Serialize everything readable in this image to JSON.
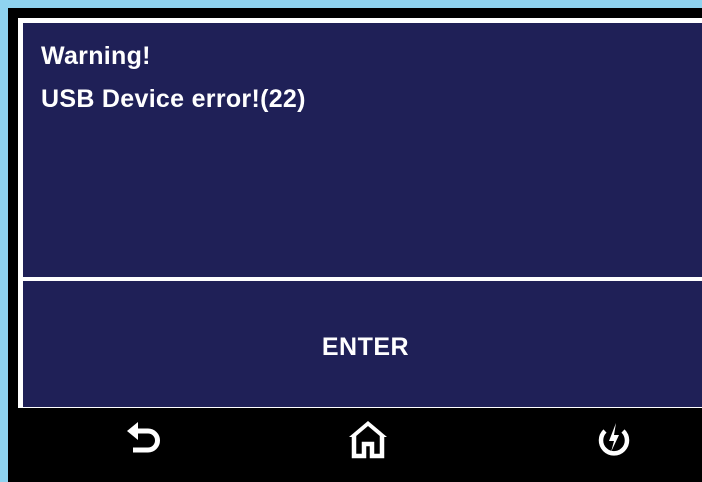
{
  "dialog": {
    "title": "Warning!",
    "message": "USB Device error!(22)",
    "enter_label": "ENTER"
  },
  "navigation": {
    "items": [
      {
        "name": "back",
        "icon": "back-arrow-icon"
      },
      {
        "name": "home",
        "icon": "home-icon"
      },
      {
        "name": "power",
        "icon": "power-icon"
      }
    ]
  },
  "colors": {
    "frame": "#8fd3f0",
    "dialog_background": "#1f2057",
    "dialog_border": "#ffffff",
    "text": "#ffffff",
    "nav_background": "#000000"
  }
}
